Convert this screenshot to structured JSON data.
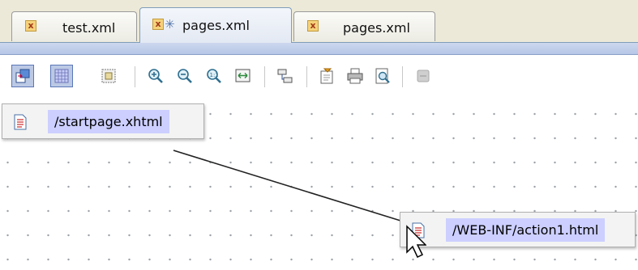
{
  "tabs": [
    {
      "label": "test.xml",
      "icon": "xml-file-icon",
      "active": false
    },
    {
      "label": "pages.xml",
      "icon": "xml-file-icon",
      "active": true,
      "modified": true
    },
    {
      "label": "pages.xml",
      "icon": "xml-file-icon",
      "active": false
    }
  ],
  "toolbar": {
    "buttons": [
      "layout-switch-icon",
      "grid-icon",
      "snap-to-grid-icon",
      "zoom-in-icon",
      "zoom-out-icon",
      "zoom-reset-icon",
      "fit-page-icon",
      "auto-layout-icon",
      "edit-properties-icon",
      "print-icon",
      "print-preview-icon",
      "disabled-action-icon"
    ]
  },
  "diagram": {
    "nodes": [
      {
        "label": "/startpage.xhtml",
        "icon": "page-icon"
      },
      {
        "label": "/WEB-INF/action1.html",
        "icon": "page-icon"
      }
    ],
    "links": [
      {
        "from": "/startpage.xhtml",
        "to": "/WEB-INF/action1.html"
      }
    ]
  },
  "colors": {
    "tab_strip": "#ece9d8",
    "active_tab": "#e3e9f3",
    "node_label_highlight": "#cccfff",
    "pressed_button": "#bcc9e4"
  }
}
